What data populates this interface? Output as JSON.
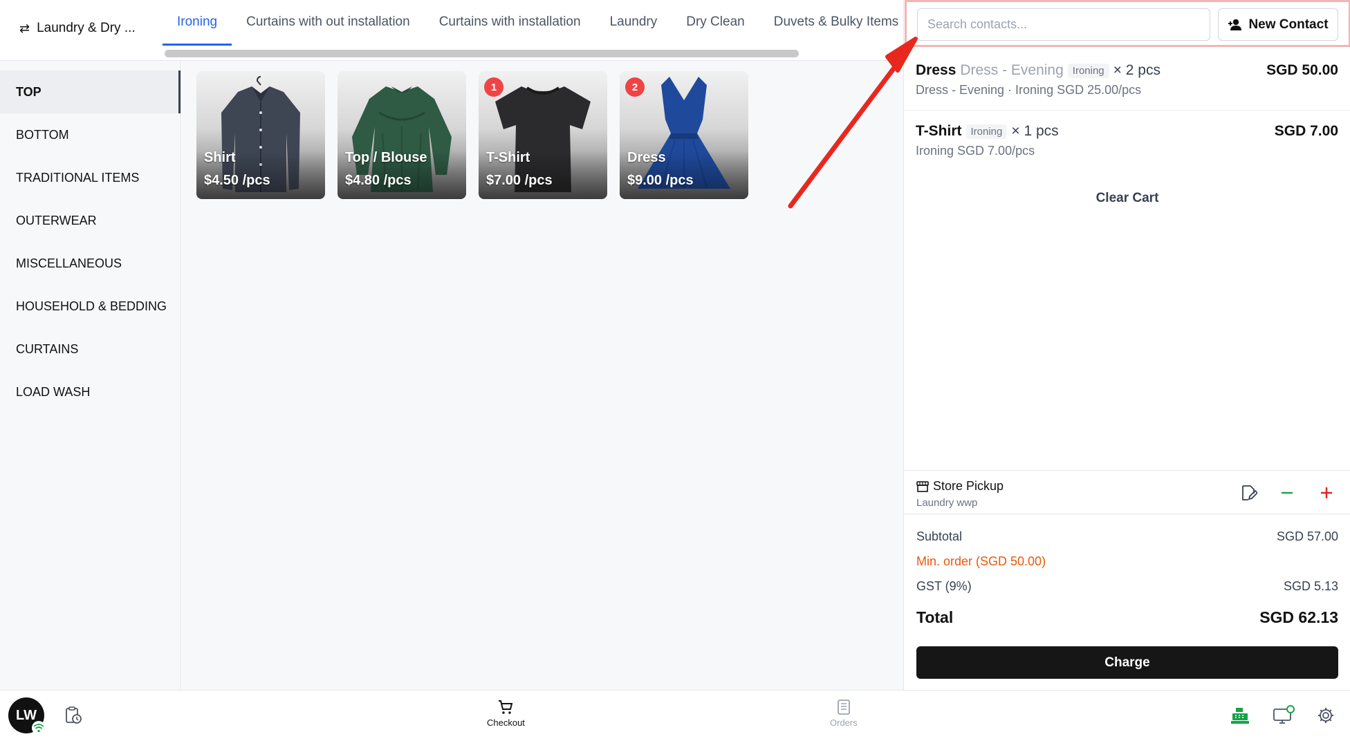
{
  "store": {
    "name": "Laundry & Dry ..."
  },
  "tabs": [
    {
      "label": "Ironing",
      "active": true
    },
    {
      "label": "Curtains with out installation",
      "active": false
    },
    {
      "label": "Curtains with installation",
      "active": false
    },
    {
      "label": "Laundry",
      "active": false
    },
    {
      "label": "Dry Clean",
      "active": false
    },
    {
      "label": "Duvets & Bulky Items",
      "active": false
    }
  ],
  "categories": [
    {
      "label": "TOP",
      "active": true
    },
    {
      "label": "BOTTOM",
      "active": false
    },
    {
      "label": "TRADITIONAL ITEMS",
      "active": false
    },
    {
      "label": "OUTERWEAR",
      "active": false
    },
    {
      "label": "MISCELLANEOUS",
      "active": false
    },
    {
      "label": "HOUSEHOLD & BEDDING",
      "active": false
    },
    {
      "label": "CURTAINS",
      "active": false
    },
    {
      "label": "LOAD WASH",
      "active": false
    }
  ],
  "products": [
    {
      "name": "Shirt",
      "price": "$4.50 /pcs",
      "badge": "",
      "image": "shirt-image"
    },
    {
      "name": "Top / Blouse",
      "price": "$4.80 /pcs",
      "badge": "",
      "image": "blouse-image"
    },
    {
      "name": "T-Shirt",
      "price": "$7.00 /pcs",
      "badge": "1",
      "image": "tshirt-image"
    },
    {
      "name": "Dress",
      "price": "$9.00 /pcs",
      "badge": "2",
      "image": "dress-image"
    }
  ],
  "contact": {
    "search_placeholder": "Search contacts...",
    "new_contact_label": "New Contact"
  },
  "cart": {
    "items": [
      {
        "name": "Dress",
        "variant": "Dress - Evening",
        "tag": "Ironing",
        "qty": "× 2 pcs",
        "detail": "Dress - Evening · Ironing SGD 25.00/pcs",
        "price": "SGD 50.00"
      },
      {
        "name": "T-Shirt",
        "variant": "",
        "tag": "Ironing",
        "qty": "× 1 pcs",
        "detail": "Ironing SGD 7.00/pcs",
        "price": "SGD 7.00"
      }
    ],
    "clear_label": "Clear Cart"
  },
  "pickup": {
    "title": "Store Pickup",
    "subtitle": "Laundry wwp"
  },
  "summary": {
    "subtotal_label": "Subtotal",
    "subtotal": "SGD 57.00",
    "min_order_label": "Min. order (SGD 50.00)",
    "gst_label": "GST (9%)",
    "gst": "SGD 5.13",
    "total_label": "Total",
    "total": "SGD 62.13",
    "charge_label": "Charge"
  },
  "bottom": {
    "avatar_initials": "LW",
    "nav": [
      {
        "label": "Checkout",
        "icon": "cart-icon",
        "active": true
      },
      {
        "label": "Orders",
        "icon": "orders-icon",
        "active": false
      }
    ]
  },
  "colors": {
    "accent": "#2563eb",
    "badge": "#ef4444",
    "warning": "#ea580c",
    "highlight_border": "#f4b4b4",
    "annotation_arrow": "#e8281e",
    "online": "#16a34a"
  }
}
